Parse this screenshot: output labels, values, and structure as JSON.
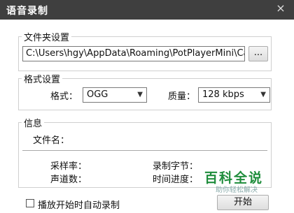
{
  "window": {
    "title": "语音录制",
    "close_glyph": "×"
  },
  "folder": {
    "legend": "文件夹设置",
    "path": "C:\\Users\\hgy\\AppData\\Roaming\\PotPlayerMini\\Capture",
    "browse_label": "..."
  },
  "format": {
    "legend": "格式设置",
    "format_label": "格式：",
    "format_value": "OGG",
    "quality_label": "质量：",
    "quality_value": "128 kbps"
  },
  "info": {
    "legend": "信息",
    "filename_label": "文件名：",
    "sample_rate_label": "采样率：",
    "bytes_label": "录制字节：",
    "channels_label": "声道数：",
    "time_label": "时间进度："
  },
  "footer": {
    "autostart_label": "播放开始时自动录制",
    "autostart_checked": false,
    "start_label": "开始"
  },
  "watermark": {
    "main": "百科全说",
    "sub": "助你轻松解决"
  },
  "colors": {
    "titlebar": "#3f3f3f",
    "watermark": "#1f8d3c"
  }
}
